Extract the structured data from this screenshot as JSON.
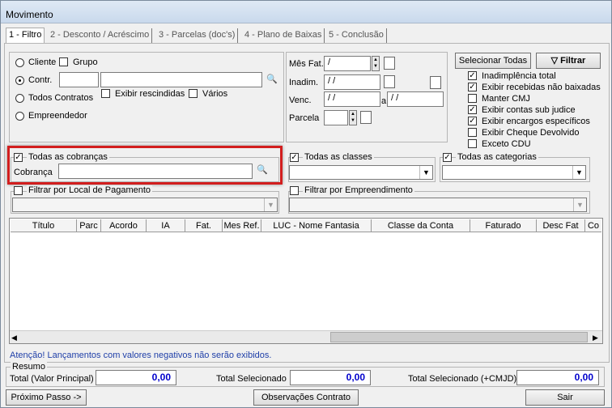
{
  "window": {
    "title": "Movimento"
  },
  "tabs": [
    "1 - Filtro",
    "2 - Desconto / Acréscimo",
    "3 - Parcelas (doc's)",
    "4 - Plano de Baixas",
    "5 - Conclusão"
  ],
  "filter": {
    "radio_cliente": "Cliente",
    "grupo": "Grupo",
    "radio_contr": "Contr.",
    "exibir_rescindidas": "Exibir rescindidas",
    "varios": "Vários",
    "radio_todos": "Todos Contratos",
    "radio_emp": "Empreendedor"
  },
  "dates": {
    "mes_fat_label": "Mês Fat.",
    "mes_fat_value": "/",
    "inadim_label": "Inadim.",
    "inadim_value": "/ /",
    "venc_label": "Venc.",
    "venc_from": "/ /",
    "venc_sep": "a",
    "venc_to": "/ /",
    "parcela_label": "Parcela"
  },
  "actions": {
    "selecionar_todas": "Selecionar Todas",
    "filtrar": "Filtrar"
  },
  "options": [
    {
      "label": "Inadimplência total",
      "checked": true
    },
    {
      "label": "Exibir recebidas não baixadas",
      "checked": true
    },
    {
      "label": "Manter CMJ",
      "checked": false
    },
    {
      "label": "Exibir contas sub judice",
      "checked": true
    },
    {
      "label": "Exibir encargos específicos",
      "checked": true
    },
    {
      "label": "Exibir Cheque Devolvido",
      "checked": false
    },
    {
      "label": "Exceto CDU",
      "checked": false
    }
  ],
  "cobrancas": {
    "all_label": "Todas as cobranças",
    "field_label": "Cobrança"
  },
  "classes": {
    "all_label": "Todas as classes"
  },
  "categorias": {
    "all_label": "Todas as categorias"
  },
  "local_pagamento": {
    "label": "Filtrar por Local de Pagamento"
  },
  "empreendimento": {
    "label": "Filtrar por Empreendimento"
  },
  "grid": {
    "columns": [
      "Título",
      "Parc",
      "Acordo",
      "IA",
      "Fat.",
      "Mes Ref.",
      "LUC - Nome Fantasia",
      "Classe da Conta",
      "Faturado",
      "Desc Fat",
      "Co"
    ]
  },
  "warning": "Atenção! Lançamentos com valores negativos não serão exibidos.",
  "resumo": {
    "title": "Resumo",
    "total_principal_label": "Total (Valor Principal)",
    "total_principal": "0,00",
    "total_selecionado_label": "Total Selecionado",
    "total_selecionado": "0,00",
    "total_cmjd_label": "Total Selecionado (+CMJD)",
    "total_cmjd": "0,00"
  },
  "footer": {
    "proximo": "Próximo Passo ->",
    "observacoes": "Observações Contrato",
    "sair": "Sair"
  }
}
